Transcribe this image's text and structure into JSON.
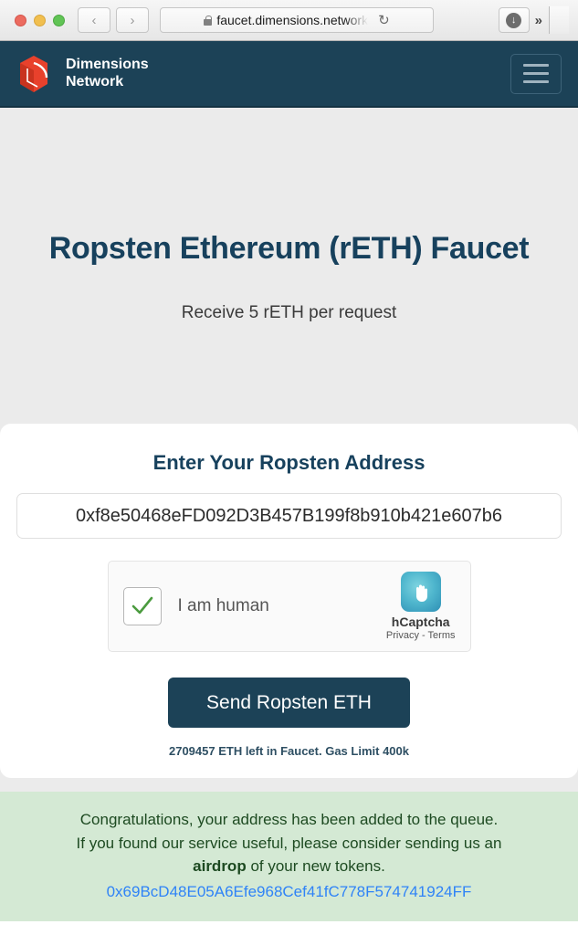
{
  "browser": {
    "traffic_lights": [
      "close",
      "minimize",
      "maximize"
    ],
    "back_label": "‹",
    "forward_label": "›",
    "url": "faucet.dimensions.network",
    "reload_label": "↻",
    "download_label": "↓",
    "overflow_label": "»",
    "lock_icon": "lock-icon"
  },
  "nav": {
    "brand_name": "Dimensions\nNetwork",
    "logo_icon": "dimensions-logo-icon",
    "menu_icon": "hamburger-menu-icon"
  },
  "hero": {
    "title": "Ropsten Ethereum (rETH) Faucet",
    "subtitle": "Receive 5 rETH per request"
  },
  "form": {
    "heading": "Enter Your Ropsten Address",
    "address_value": "0xf8e50468eFD092D3B457B199f8b910b421e607b6",
    "address_placeholder": "Enter Your Ropsten Address",
    "captcha": {
      "label": "I am human",
      "checked": true,
      "check_glyph": "✓",
      "brand": "hCaptcha",
      "links": "Privacy - Terms",
      "logo_icon": "hcaptcha-hand-icon"
    },
    "submit_label": "Send Ropsten ETH",
    "faucet_status": "2709457 ETH left in Faucet. Gas Limit 400k"
  },
  "success": {
    "line1": "Congratulations, your address has been added to the queue.",
    "line2_before": "If you found our service useful, please consider sending us an",
    "line2_bold": "airdrop",
    "line2_after": "of your new tokens.",
    "donation_address": "0x69BcD48E05A6Efe968Cef41fC778F574741924FF"
  },
  "colors": {
    "brand_navy": "#1c4257",
    "brand_red": "#e8412c",
    "heading_blue": "#17415d",
    "page_gray": "#ebebeb",
    "success_bg": "#d4e9d4",
    "success_text": "#1d4a21",
    "link_blue": "#2f83f7",
    "check_green": "#4b9b3f"
  }
}
